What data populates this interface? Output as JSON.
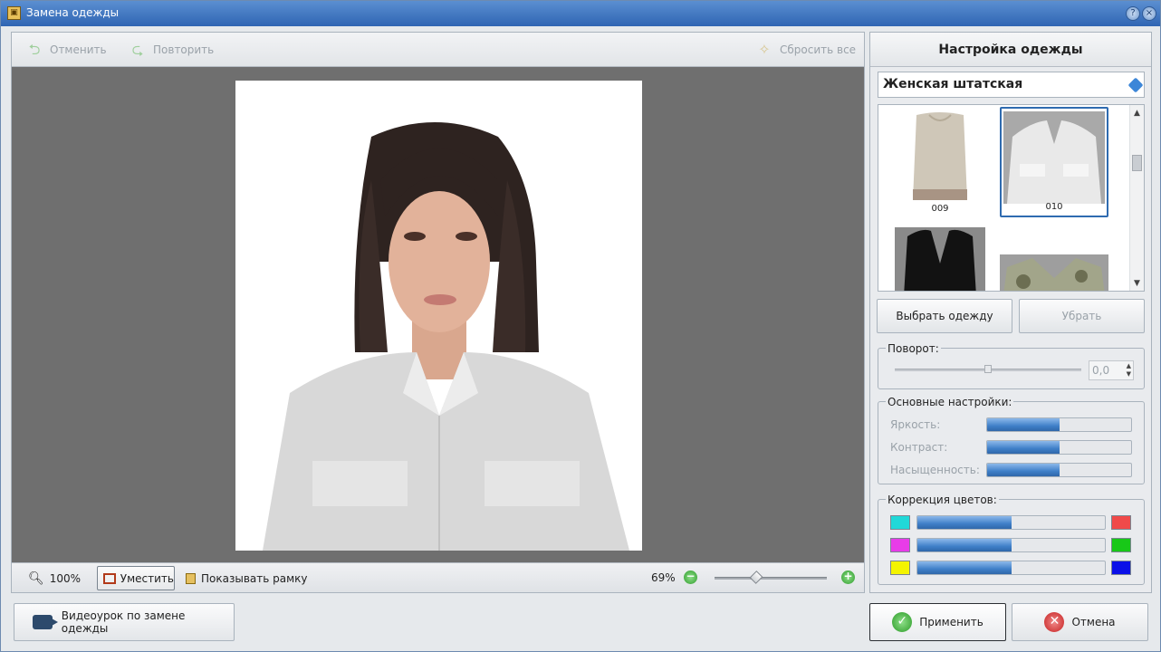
{
  "window": {
    "title": "Замена одежды"
  },
  "toolbar": {
    "undo_label": "Отменить",
    "redo_label": "Повторить",
    "reset_label": "Сбросить все"
  },
  "bottombar": {
    "zoom_100_label": "100%",
    "fit_label": "Уместить",
    "show_frame_label": "Показывать рамку",
    "zoom_value": "69%",
    "zoom_slider_fraction": 0.37
  },
  "video_button": {
    "label": "Видеоурок по замене одежды"
  },
  "settings": {
    "header": "Настройка одежды",
    "category_value": "Женская штатская",
    "gallery": [
      {
        "caption": "009",
        "selected": false
      },
      {
        "caption": "010",
        "selected": true
      },
      {
        "caption": "",
        "selected": false
      },
      {
        "caption": "",
        "selected": false
      }
    ],
    "choose_button": "Выбрать одежду",
    "remove_button": "Убрать",
    "rotation": {
      "legend": "Поворот:",
      "value": "0,0",
      "slider_fraction": 0.5
    },
    "basic": {
      "legend": "Основные настройки:",
      "brightness_label": "Яркость:",
      "contrast_label": "Контраст:",
      "saturation_label": "Насыщенность:",
      "brightness": 0.5,
      "contrast": 0.5,
      "saturation": 0.5
    },
    "color_correction": {
      "legend": "Коррекция цветов:",
      "rows": [
        {
          "left_color": "#20d8d8",
          "right_color": "#f04a4a",
          "value": 0.5
        },
        {
          "left_color": "#e83ce8",
          "right_color": "#18c818",
          "value": 0.5
        },
        {
          "left_color": "#f4f400",
          "right_color": "#0a10e8",
          "value": 0.5
        }
      ]
    }
  },
  "footer": {
    "apply_label": "Применить",
    "cancel_label": "Отмена"
  }
}
